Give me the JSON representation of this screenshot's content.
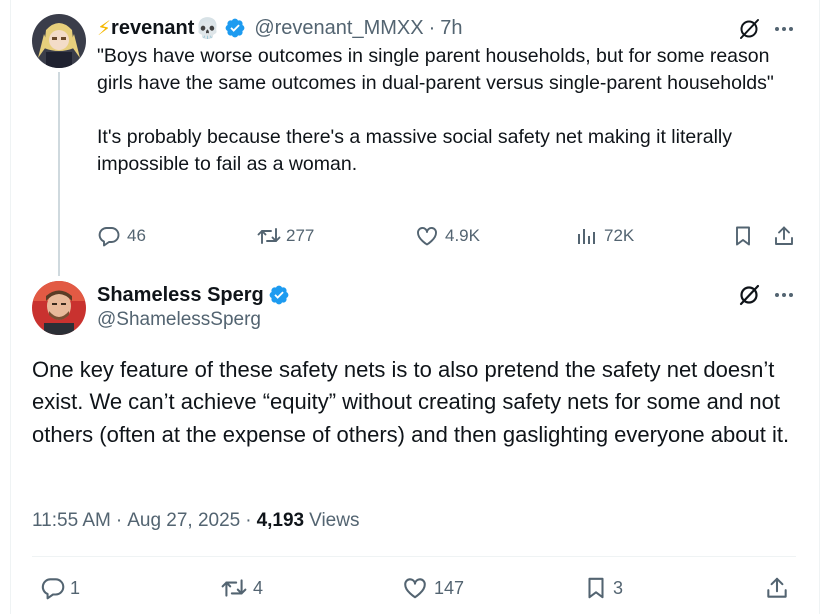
{
  "parent_tweet": {
    "name_prefix": "⚡",
    "name": "revenant",
    "name_suffix": "💀",
    "handle": "@revenant_MMXX",
    "separator": "·",
    "time": "7h",
    "body_quote": "\"Boys have worse outcomes in single parent households, but for some reason girls have the same outcomes in dual-parent versus single-parent households\"",
    "body_text": "It's probably because there's a massive social safety net making it literally impossible to fail as a woman.",
    "replies": "46",
    "reposts": "277",
    "likes": "4.9K",
    "views": "72K"
  },
  "main_tweet": {
    "name": "Shameless Sperg",
    "handle": "@ShamelessSperg",
    "body": "One key feature of these safety nets is to also pretend the safety net doesn’t exist. We can’t achieve “equity” without creating safety nets for some and not others (often at the expense of others) and then gaslighting everyone about it.",
    "time": "11:55 AM",
    "date": "Aug 27, 2025",
    "separator": "·",
    "views_count": "4,193",
    "views_label": "Views",
    "replies": "1",
    "reposts": "4",
    "likes": "147",
    "bookmarks": "3"
  },
  "colors": {
    "verified": "#1d9bf0",
    "text_primary": "#0f1419",
    "text_secondary": "#536471",
    "thread_line": "#cfd9de"
  },
  "icons": [
    "verified-badge-icon",
    "grok-icon",
    "more-icon",
    "reply-icon",
    "repost-icon",
    "like-icon",
    "views-icon",
    "bookmark-icon",
    "share-icon"
  ]
}
